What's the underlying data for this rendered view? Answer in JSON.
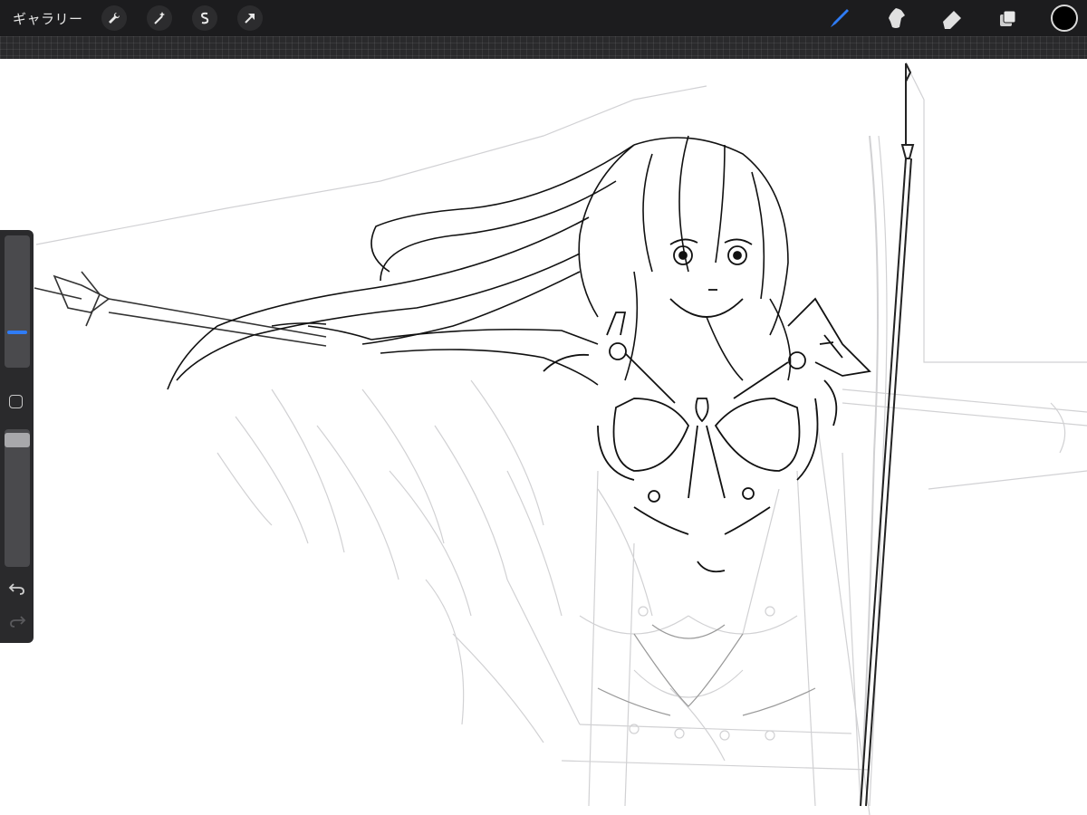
{
  "toolbar": {
    "gallery_label": "ギャラリー",
    "left_tools": [
      "actions-wrench-icon",
      "adjustments-magic-wand-icon",
      "selection-icon",
      "transform-arrow-icon"
    ],
    "right_tools": [
      "brush-icon",
      "smudge-icon",
      "eraser-icon",
      "layers-icon"
    ],
    "active_tool": "brush-icon",
    "active_tool_color": "#2f7cf6",
    "current_color": "#000000"
  },
  "sidebar": {
    "brush_size_fraction": 0.75,
    "opacity_fraction": 1.0,
    "accent_color": "#2f7cf6",
    "undo_icon": "undo-icon",
    "redo_icon": "redo-icon",
    "redo_enabled": false
  },
  "canvas": {
    "background": "#ffffff",
    "content": "line-art-illustration"
  }
}
